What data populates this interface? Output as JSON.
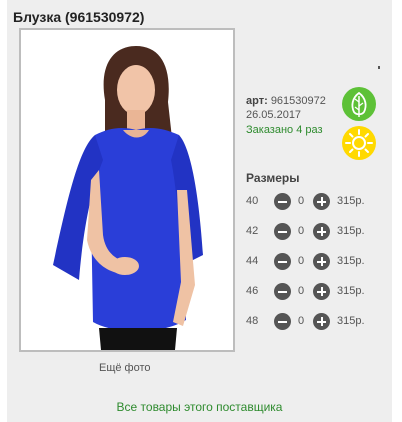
{
  "product": {
    "title": "Блузка (961530972)",
    "more_photos": "Ещё фото",
    "dot": ",",
    "article_label": "арт:",
    "article_value": "961530972",
    "date": "26.05.2017",
    "ordered": "Заказано 4 раз"
  },
  "icons": {
    "leaf": "leaf-icon",
    "sun": "sun-icon",
    "leaf_color": "#5dc137",
    "sun_color": "#ffd900"
  },
  "sizes": {
    "title": "Размеры",
    "rows": [
      {
        "size": "40",
        "qty": "0",
        "price": "315р."
      },
      {
        "size": "42",
        "qty": "0",
        "price": "315р."
      },
      {
        "size": "44",
        "qty": "0",
        "price": "315р."
      },
      {
        "size": "46",
        "qty": "0",
        "price": "315р."
      },
      {
        "size": "48",
        "qty": "0",
        "price": "315р."
      }
    ]
  },
  "supplier_link": "Все товары этого поставщика"
}
